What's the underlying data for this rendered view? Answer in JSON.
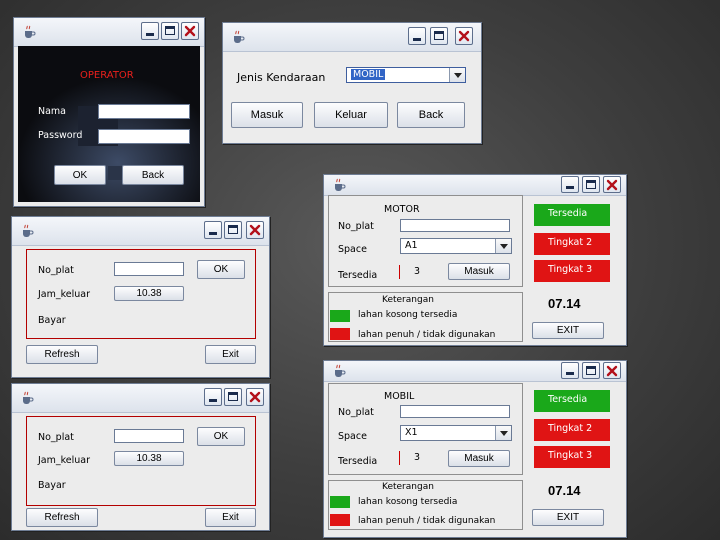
{
  "login": {
    "heading": "OPERATOR",
    "nama_label": "Nama",
    "password_label": "Password",
    "ok_label": "OK",
    "back_label": "Back",
    "nama_value": "",
    "password_value": ""
  },
  "select_win": {
    "jenis_label": "Jenis Kendaraan",
    "jenis_value": "MOBIL",
    "masuk_label": "Masuk",
    "keluar_label": "Keluar",
    "back_label": "Back"
  },
  "exit_win_1": {
    "no_plat_label": "No_plat",
    "jam_keluar_label": "Jam_keluar",
    "jam_keluar_value": "10.38",
    "bayar_label": "Bayar",
    "ok_label": "OK",
    "refresh_label": "Refresh",
    "exit_label": "Exit"
  },
  "exit_win_2": {
    "no_plat_label": "No_plat",
    "jam_keluar_label": "Jam_keluar",
    "jam_keluar_value": "10.38",
    "bayar_label": "Bayar",
    "ok_label": "OK",
    "refresh_label": "Refresh",
    "exit_label": "Exit"
  },
  "motor_win": {
    "heading": "MOTOR",
    "no_plat_label": "No_plat",
    "space_label": "Space",
    "space_value": "A1",
    "tersedia_label": "Tersedia",
    "tersedia_value": "3",
    "masuk_label": "Masuk",
    "status_1": "Tersedia",
    "status_2": "Tingkat 2",
    "status_3": "Tingkat 3",
    "keterangan_label": "Keterangan",
    "legend_green": "lahan kosong tersedia",
    "legend_red": "lahan penuh / tidak digunakan",
    "clock": "07.14",
    "exit_label": "EXIT"
  },
  "mobil_win": {
    "heading": "MOBIL",
    "no_plat_label": "No_plat",
    "space_label": "Space",
    "space_value": "X1",
    "tersedia_label": "Tersedia",
    "tersedia_value": "3",
    "masuk_label": "Masuk",
    "status_1": "Tersedia",
    "status_2": "Tingkat 2",
    "status_3": "Tingkat 3",
    "keterangan_label": "Keterangan",
    "legend_green": "lahan kosong tersedia",
    "legend_red": "lahan penuh / tidak digunakan",
    "clock": "07.14",
    "exit_label": "EXIT"
  },
  "colors": {
    "green": "#1aa81a",
    "red": "#e01414",
    "operator_red": "#e8201c"
  },
  "icons": {
    "app": "java-cup-icon",
    "minimize": "minimize-icon",
    "maximize": "maximize-icon",
    "close": "close-icon"
  }
}
